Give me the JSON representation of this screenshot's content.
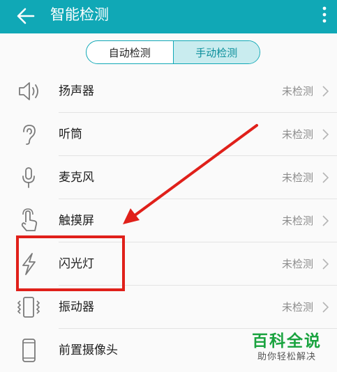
{
  "header": {
    "title": "智能检测",
    "back_icon": "back-arrow-icon",
    "more_icon": "more-vertical-icon",
    "color": "#10a8b6"
  },
  "tabs": [
    {
      "label": "自动检测",
      "active": false
    },
    {
      "label": "手动检测",
      "active": true
    }
  ],
  "items": [
    {
      "label": "扬声器",
      "status": "未检测",
      "icon": "speaker-icon"
    },
    {
      "label": "听筒",
      "status": "未检测",
      "icon": "earpiece-icon"
    },
    {
      "label": "麦克风",
      "status": "未检测",
      "icon": "microphone-icon"
    },
    {
      "label": "触摸屏",
      "status": "未检测",
      "icon": "touch-icon"
    },
    {
      "label": "闪光灯",
      "status": "未检测",
      "icon": "flash-icon"
    },
    {
      "label": "振动器",
      "status": "未检测",
      "icon": "vibration-icon"
    },
    {
      "label": "前置摄像头",
      "status": "",
      "icon": "phone-icon"
    }
  ],
  "watermark": {
    "title": "百科全说",
    "subtitle": "助你轻松解决"
  },
  "annotation_color": "#e0201a"
}
